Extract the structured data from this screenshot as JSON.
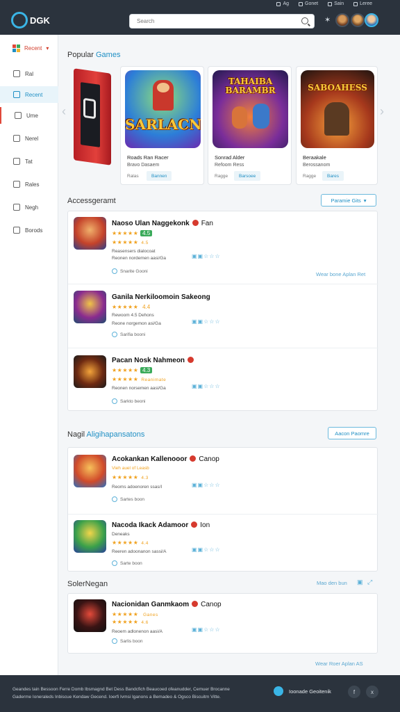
{
  "header": {
    "logo_text": "DGK",
    "search_placeholder": "Search",
    "top_links": [
      "Ag",
      "Gonet",
      "Sain",
      "Leree"
    ],
    "star_icon": "star-icon"
  },
  "sidebar": {
    "top_label": "Recent",
    "items": [
      {
        "label": "Ral"
      },
      {
        "label": "Recent"
      },
      {
        "label": "Ume"
      },
      {
        "label": "Nerel"
      },
      {
        "label": "Tat"
      },
      {
        "label": "Rales"
      },
      {
        "label": "Negh"
      },
      {
        "label": "Borods"
      }
    ]
  },
  "featured": {
    "title_a": "Popular ",
    "title_b": "Games",
    "cards": [
      {
        "art_text": "SARLACN",
        "name": "Roads Ran Racer",
        "sub": "Bravo Dasaem",
        "chip1": "Ralas",
        "chip2": "Bannen"
      },
      {
        "art_text": "TAHAIBA BARAMBR",
        "name": "Sonrad Alder",
        "sub": "Refoom Ress",
        "chip1": "Ragge",
        "chip2": "Barsoee"
      },
      {
        "art_text": "SABOAHESS",
        "name": "Beraakale",
        "sub": "Berossanom",
        "chip1": "Ragge",
        "chip2": "Bares"
      }
    ]
  },
  "recommended": {
    "title": "Accessgeramt",
    "button": "Paramie Gits",
    "link": "Wear bone Aplan Ret",
    "items": [
      {
        "title": "Naoso Ulan Naggekonk",
        "title2": "Fan",
        "meta1": "Reasensers dialocoat",
        "meta2": "Reonen nordemen aasi/Ga",
        "rating": "4.5",
        "note": "Snarite Gooni"
      },
      {
        "title": "Ganila Nerkiloomoin Sakeong",
        "title2": "",
        "meta1": "Rewoom 4.5 Dehons",
        "meta2": "Reone norgemon asi/Ga",
        "rating": "4.4",
        "note": "Sarifia booni"
      },
      {
        "title": "Pacan Nosk Nahmeon",
        "title2": "",
        "meta1": "Reanimate",
        "meta2": "Reonen norsemen aasi/Ga",
        "rating": "4.3",
        "note": "Sarkto beoni"
      }
    ]
  },
  "special": {
    "title_a": "Nagil ",
    "title_b": "Aligihapansatons",
    "button": "Aacon Paomre",
    "items": [
      {
        "title": "Acokankan Kallenooor",
        "title2": "Canop",
        "meta1": "Vieh auel of Leasb",
        "meta2": "Reoms adoenoren ssas/I",
        "rating": "4.3",
        "note": "Sartes boon"
      },
      {
        "title": "Nacoda Ikack Adamoor",
        "title2": "Ion",
        "meta1": "Deneaks",
        "meta2": "Reeren adoonanon sassi/A",
        "rating": "4.4",
        "note": "Sarte boon"
      }
    ]
  },
  "upcoming": {
    "title": "SolerNegan",
    "link": "Mao den bun",
    "items": [
      {
        "title": "Nacionidan Ganmkaom",
        "title2": "Canop",
        "meta1": "Ganes",
        "meta2": "Reoem adlonenon aasi/A",
        "rating": "4.6",
        "note": "Sarlis boon"
      }
    ],
    "more_link": "Wear Roer Aplan AS"
  },
  "footer": {
    "text": "Geandes tain Bessoon Ferre Domb Ibsmagnd Bet Dess Bandcfich Beaucoed ofeanudder, Cemuer Brocanne Gaderme Ioneraleds Inbiscue Kendaw Gecend. Ioerfi Ivmsi Iganons a Bemadeo & Ogsco Biscuitm Vitte.",
    "brand": "Ioonade Geoitenik",
    "social": [
      "f",
      "x"
    ]
  },
  "colors": {
    "accent": "#1f8fc4",
    "header_bg": "#2b333d",
    "star": "#f0a11e",
    "danger": "#d63a2e"
  }
}
